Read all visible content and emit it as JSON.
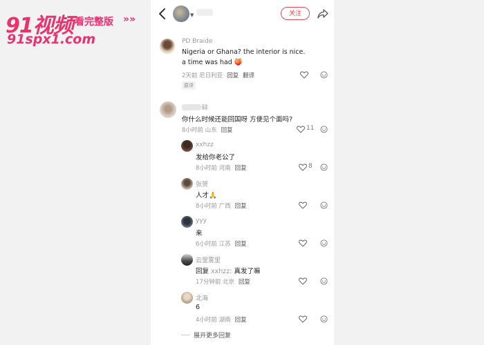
{
  "watermark": {
    "logo": "91视频",
    "tagline": "看完整版",
    "arrows": "»»",
    "url": "91spx1.com"
  },
  "topbar": {
    "follow_label": "关注"
  },
  "comments": [
    {
      "username": "PD Braide",
      "lines": [
        "Nigeria or Ghana? the interior is nice.",
        "a time was had 🍑"
      ],
      "time": "2天前 尼日利亚",
      "reply": "回复",
      "translate": "翻译",
      "tag": "原评",
      "likes": ""
    },
    {
      "username_suffix": "碎",
      "text": "你什么时候还能回国呀 方便见个面吗?",
      "time": "8小时前 山东",
      "reply": "回复",
      "likes": "11"
    }
  ],
  "replies": [
    {
      "username": "xxhzz",
      "text": "发给你老公了",
      "time": "8小时前 河南",
      "reply": "回复",
      "likes": "8"
    },
    {
      "username": "张贺",
      "text": "人才🙏",
      "time": "8小时前 广西",
      "reply": "回复",
      "likes": ""
    },
    {
      "username": "yyy",
      "text": "来",
      "time": "6小时前 江苏",
      "reply": "回复",
      "likes": ""
    },
    {
      "username": "云里雾里",
      "text_prefix": "回复",
      "text_mention": "xxhzz:",
      "text": "真发了嘛",
      "time": "17分钟前 北京",
      "reply": "回复",
      "likes": ""
    },
    {
      "username": "北海",
      "text": "6",
      "time": "4小时前 湖南",
      "reply": "回复",
      "likes": ""
    }
  ],
  "expand_more": "展开更多回复",
  "colors": {
    "accent": "#e34a5a",
    "watermark": "#e8336f",
    "muted": "#999999"
  }
}
